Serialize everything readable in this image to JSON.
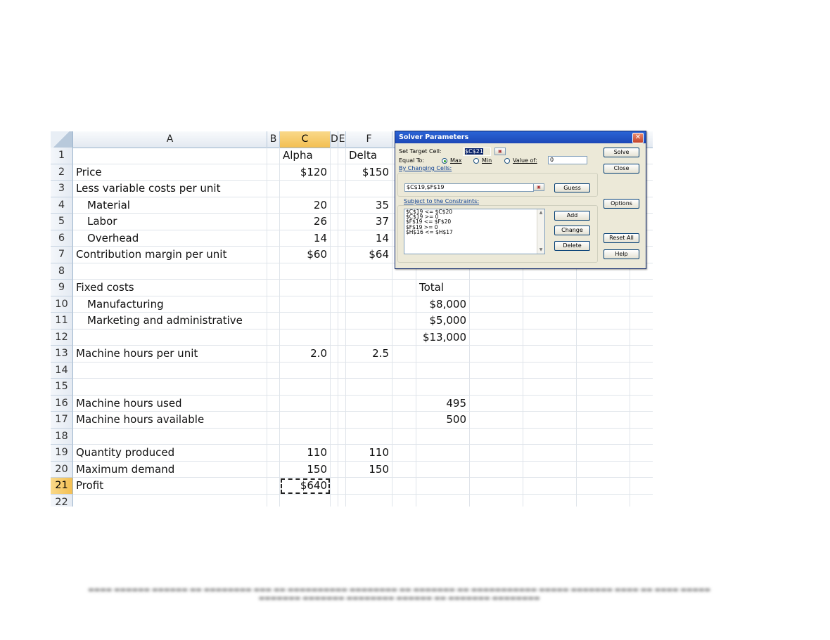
{
  "sheet": {
    "column_headers": [
      "A",
      "B",
      "C",
      "D",
      "E",
      "F"
    ],
    "selected_column": "C",
    "selected_row": "21",
    "rows": [
      {
        "n": "1",
        "A": "",
        "C": "Alpha",
        "F": "Delta",
        "G": ""
      },
      {
        "n": "2",
        "A": "Price",
        "C": "$120",
        "F": "$150",
        "G": ""
      },
      {
        "n": "3",
        "A": "Less variable costs per unit",
        "C": "",
        "F": "",
        "G": ""
      },
      {
        "n": "4",
        "A": "Material",
        "C": "20",
        "F": "35",
        "G": ""
      },
      {
        "n": "5",
        "A": "Labor",
        "C": "26",
        "F": "37",
        "G": ""
      },
      {
        "n": "6",
        "A": "Overhead",
        "C": "14",
        "F": "14",
        "G": ""
      },
      {
        "n": "7",
        "A": "Contribution margin per unit",
        "C": "$60",
        "F": "$64",
        "G": ""
      },
      {
        "n": "8",
        "A": "",
        "C": "",
        "F": "",
        "G": ""
      },
      {
        "n": "9",
        "A": "Fixed costs",
        "C": "",
        "F": "",
        "G": "Total"
      },
      {
        "n": "10",
        "A": "Manufacturing",
        "C": "",
        "F": "",
        "G": "$8,000"
      },
      {
        "n": "11",
        "A": "Marketing and administrative",
        "C": "",
        "F": "",
        "G": "$5,000"
      },
      {
        "n": "12",
        "A": "",
        "C": "",
        "F": "",
        "G": "$13,000"
      },
      {
        "n": "13",
        "A": "Machine hours per unit",
        "C": "2.0",
        "F": "2.5",
        "G": ""
      },
      {
        "n": "14",
        "A": "",
        "C": "",
        "F": "",
        "G": ""
      },
      {
        "n": "15",
        "A": "",
        "C": "",
        "F": "",
        "G": ""
      },
      {
        "n": "16",
        "A": "Machine hours used",
        "C": "",
        "F": "",
        "G": "495"
      },
      {
        "n": "17",
        "A": "Machine hours available",
        "C": "",
        "F": "",
        "G": "500"
      },
      {
        "n": "18",
        "A": "",
        "C": "",
        "F": "",
        "G": ""
      },
      {
        "n": "19",
        "A": "Quantity produced",
        "C": "110",
        "F": "110",
        "G": ""
      },
      {
        "n": "20",
        "A": "Maximum demand",
        "C": "150",
        "F": "150",
        "G": ""
      },
      {
        "n": "21",
        "A": "Profit",
        "C": "$640",
        "F": "",
        "G": ""
      },
      {
        "n": "22",
        "A": "",
        "C": "",
        "F": "",
        "G": ""
      }
    ]
  },
  "solver": {
    "title": "Solver Parameters",
    "set_target_label": "Set Target Cell:",
    "target_cell": "$C$21",
    "equal_to_label": "Equal To:",
    "opt_max": "Max",
    "opt_min": "Min",
    "opt_value": "Value of:",
    "value_of": "0",
    "changing_label": "By Changing Cells:",
    "changing_cells": "$C$19,$F$19",
    "constraints_label": "Subject to the Constraints:",
    "constraints": [
      "$C$19 <= $C$20",
      "$C$19 >= 0",
      "$F$19 <= $F$20",
      "$F$19 >= 0",
      "$H$16 <= $H$17"
    ],
    "buttons": {
      "solve": "Solve",
      "close": "Close",
      "guess": "Guess",
      "options": "Options",
      "add": "Add",
      "change": "Change",
      "delete": "Delete",
      "reset_all": "Reset All",
      "help": "Help"
    }
  }
}
